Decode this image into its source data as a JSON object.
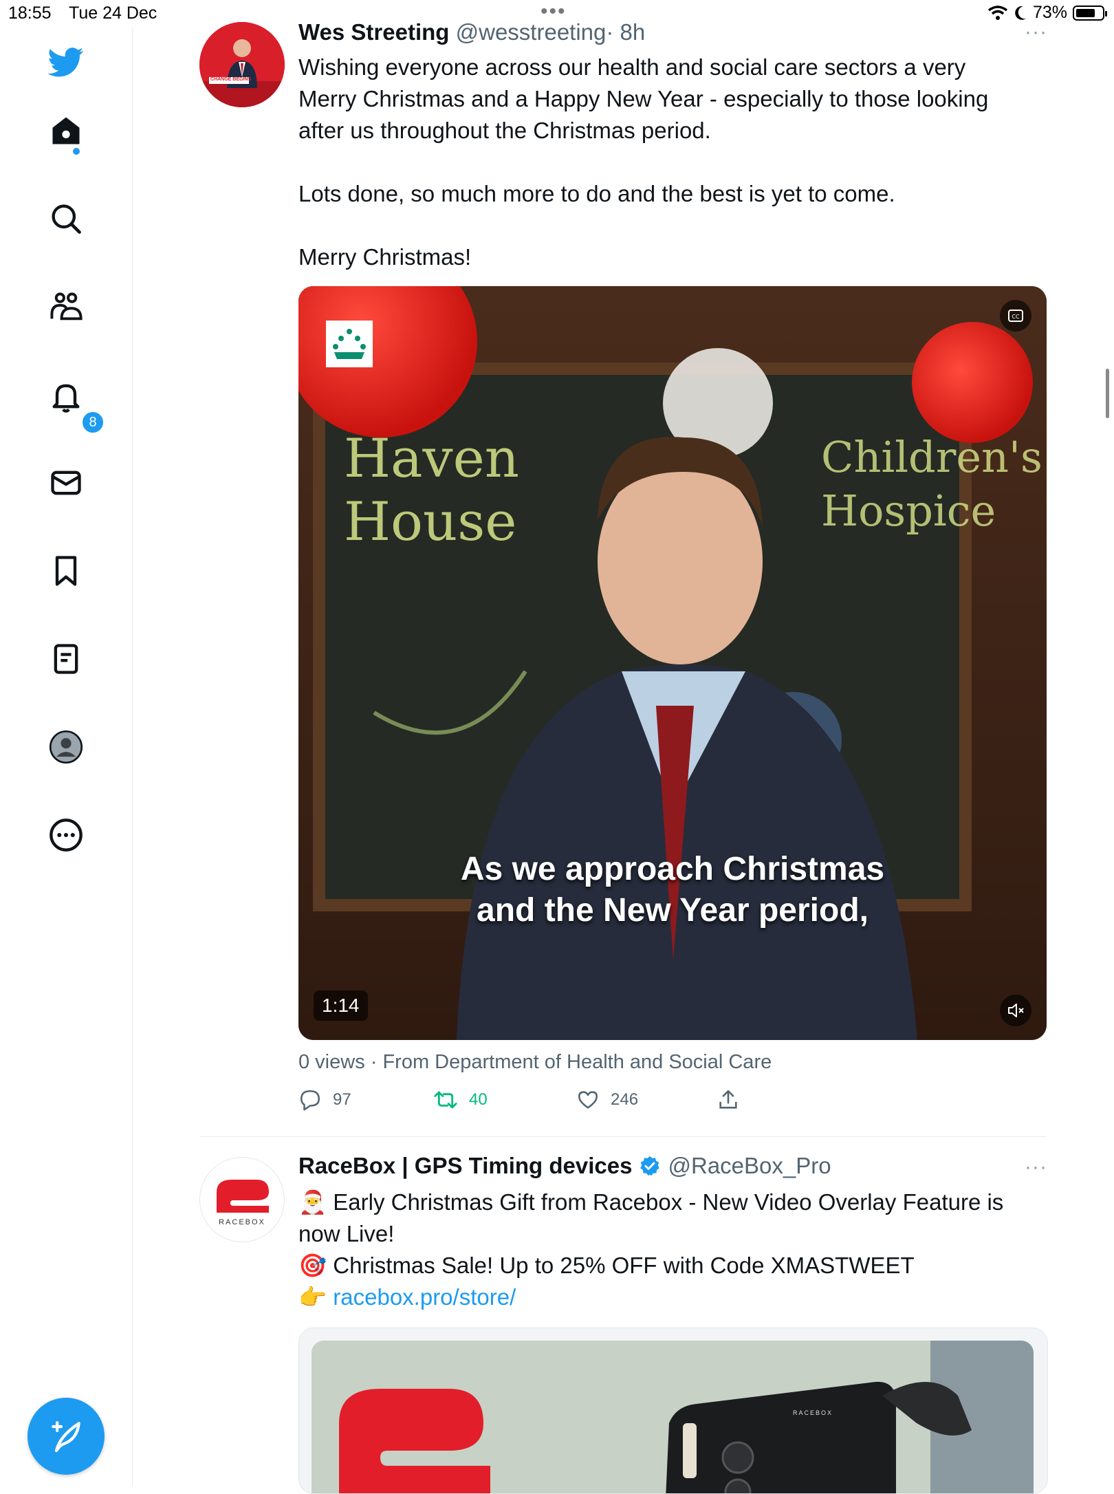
{
  "status_bar": {
    "time": "18:55",
    "date": "Tue 24 Dec",
    "battery": "73%"
  },
  "sidebar": {
    "notifications_badge": "8",
    "items": [
      "twitter-logo",
      "home",
      "search",
      "communities",
      "notifications",
      "messages",
      "bookmarks",
      "lists",
      "profile",
      "more"
    ]
  },
  "tweet1": {
    "name": "Wes Streeting",
    "handle": "@wesstreeting",
    "time": "· 8h",
    "text": "Wishing everyone across our health and social care sectors a very\nMerry Christmas and a Happy New Year - especially to those looking\nafter us throughout the Christmas period.\n\nLots done, so much more to do and the best is yet to come.\n\nMerry Christmas!",
    "avatar_caption": "CHANGE BEGINS",
    "video": {
      "caption_line1": "As we approach Christmas",
      "caption_line2": "and the New Year period,",
      "duration": "1:14",
      "chalk_left": "Haven House",
      "chalk_right": "Children's Hospice"
    },
    "views_line": "0 views · From Department of Health and Social Care",
    "replies": "97",
    "retweets": "40",
    "likes": "246"
  },
  "tweet2": {
    "name": "RaceBox | GPS Timing devices",
    "handle": "@RaceBox_Pro",
    "avatar_label": "RACEBOX",
    "line1_emoji": "🎅",
    "line1": "Early Christmas Gift from Racebox - New Video Overlay Feature is",
    "line2": "now Live!",
    "line3_emoji": "🎯",
    "line3": "Christmas Sale! Up to 25% OFF with Code XMASTWEET",
    "line4_emoji": "👉",
    "link": "racebox.pro/store/",
    "product_label": "RACEBOX"
  },
  "colors": {
    "accent": "#1d9bf0",
    "retweet": "#00ba7c",
    "muted": "#536471"
  }
}
